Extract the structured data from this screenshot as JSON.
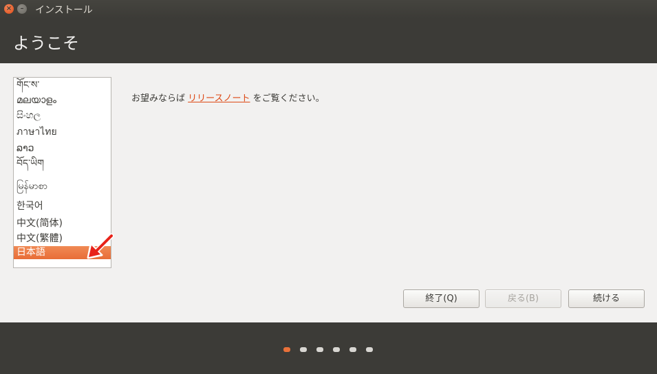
{
  "window": {
    "title": "インストール",
    "close_glyph": "×",
    "minimize_glyph": "–"
  },
  "header": {
    "title": "ようこそ"
  },
  "language_list": {
    "items": [
      "གོང་ས་",
      "മലയാളം",
      "සිංහල",
      "ภาษาไทย",
      "ລາວ",
      "བོད་ཡིག",
      "မြန်မာစာ",
      "한국어",
      "中文(简体)",
      "中文(繁體)",
      "日本語"
    ],
    "selected_index": 10
  },
  "release_notes": {
    "prefix": "お望みならば",
    "link": "リリースノート",
    "suffix": "をご覧ください。"
  },
  "buttons": {
    "quit": "終了(Q)",
    "back": "戻る(B)",
    "continue": "続ける"
  },
  "progress": {
    "total_steps": 6,
    "current_step": 1
  },
  "colors": {
    "accent": "#e9713a",
    "link": "#dd4814",
    "selection": "#ec7842"
  }
}
